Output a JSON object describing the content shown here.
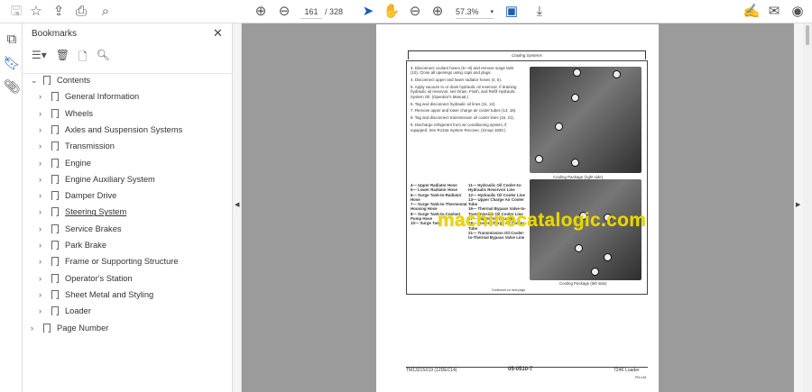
{
  "toolbar": {
    "current_page": "161",
    "total_pages": "/ 328",
    "zoom": "57.3%"
  },
  "panel": {
    "title": "Bookmarks"
  },
  "bookmarks": [
    {
      "label": "Contents",
      "level": 0
    },
    {
      "label": "General Information",
      "level": 1
    },
    {
      "label": "Wheels",
      "level": 1
    },
    {
      "label": "Axles and Suspension Systems",
      "level": 1
    },
    {
      "label": "Transmission",
      "level": 1
    },
    {
      "label": "Engine",
      "level": 1
    },
    {
      "label": "Engine Auxiliary System",
      "level": 1
    },
    {
      "label": "Damper Drive",
      "level": 1
    },
    {
      "label": "Steering System",
      "level": 1
    },
    {
      "label": "Service Brakes",
      "level": 1
    },
    {
      "label": "Park Brake",
      "level": 1
    },
    {
      "label": "Frame or Supporting Structure",
      "level": 1
    },
    {
      "label": "Operator's Station",
      "level": 1
    },
    {
      "label": "Sheet Metal and Styling",
      "level": 1
    },
    {
      "label": "Loader",
      "level": 1
    },
    {
      "label": "Page Number",
      "level": 0
    }
  ],
  "doc": {
    "section_title": "Cooling Systems",
    "steps": [
      "3.  Disconnect coolant hoses (6—8) and remove surge tank (10). Close all openings using caps and plugs.",
      "4.  Disconnect upper and lower radiator hoses (4, 5).",
      "5.  Apply vacuum to or drain hydraulic oil reservoir. If draining hydraulic oil reservoir, see Drain, Flush, and Refill Hydraulic System Oil. (Operator's Manual.)",
      "6.  Tag and disconnect hydraulic oil lines (11, 12).",
      "7.  Remove upper and lower charge air cooler tubes (13, 18).",
      "8.  Tag and disconnect transmission oil cooler lines (16, 21).",
      "9.  Discharge refrigerant from air conditioning system, if equipped. See R134a System Recover. (Group 1830.)"
    ],
    "caption1": "Cooling Package (right side)",
    "caption2": "Cooling Package (left side)",
    "legend_left": [
      "4— Upper Radiator Hose",
      "5— Lower Radiator Hose",
      "6— Surge Tank-to-Radiator Hose",
      "7— Surge Tank-to-Thermostat Housing Hose",
      "8— Surge Tank-to-Coolant Pump Hose",
      "10— Surge Tank"
    ],
    "legend_right": [
      "11— Hydraulic Oil Cooler-to-Hydraulic Reservoir Line",
      "12— Hydraulic Oil Cooler Line",
      "13— Upper Charge Air Cooler Tube",
      "16— Thermal Bypass Valve-to-Transmission Oil Cooler Line",
      "17— Cap Screw (4 used)",
      "18— Lower Charge Air Cooler Tube",
      "21— Transmission Oil Cooler-to-Thermal Bypass Valve Line"
    ],
    "continued": "Continued on next page",
    "footer_left": "TM13215X19 (12DEC14)",
    "footer_center": "05-0510-7",
    "footer_right": "724K Loader",
    "footer_sub": "PN=161",
    "watermark": "machinecatalogic.com"
  }
}
